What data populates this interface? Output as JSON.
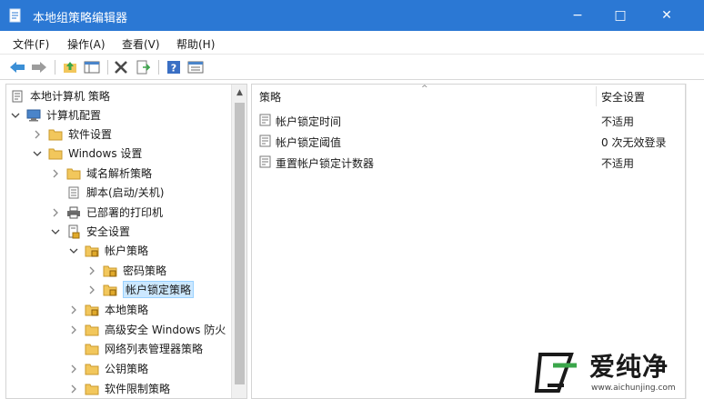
{
  "window": {
    "title": "本地组策略编辑器",
    "minimize_glyph": "−",
    "maximize_glyph": "□",
    "close_glyph": "✕"
  },
  "menu": [
    "文件(F)",
    "操作(A)",
    "查看(V)",
    "帮助(H)"
  ],
  "toolbar_icons": [
    "back-arrow-icon",
    "forward-arrow-icon",
    "folder-up-icon",
    "show-hide-tree-icon",
    "delete-icon",
    "export-list-icon",
    "help-icon",
    "properties-icon"
  ],
  "tree": {
    "chevron_expanded": "⌵",
    "chevron_collapsed": "›",
    "items": [
      {
        "label": "本地计算机 策略",
        "icon": "policy-doc-icon",
        "expander": "none",
        "level": 0
      },
      {
        "label": "计算机配置",
        "icon": "computer-icon",
        "expander": "expanded",
        "level": 0
      },
      {
        "label": "软件设置",
        "icon": "folder-icon",
        "expander": "collapsed",
        "level": 1
      },
      {
        "label": "Windows 设置",
        "icon": "folder-icon",
        "expander": "expanded",
        "level": 1
      },
      {
        "label": "域名解析策略",
        "icon": "folder-icon",
        "expander": "collapsed",
        "level": 2
      },
      {
        "label": "脚本(启动/关机)",
        "icon": "script-icon",
        "expander": "none",
        "level": 2
      },
      {
        "label": "已部署的打印机",
        "icon": "printer-icon",
        "expander": "collapsed",
        "level": 2
      },
      {
        "label": "安全设置",
        "icon": "security-settings-icon",
        "expander": "expanded",
        "level": 2
      },
      {
        "label": "帐户策略",
        "icon": "locked-folder-icon",
        "expander": "expanded",
        "level": 3
      },
      {
        "label": "密码策略",
        "icon": "locked-folder-icon",
        "expander": "collapsed",
        "level": 4
      },
      {
        "label": "帐户锁定策略",
        "icon": "locked-folder-icon",
        "expander": "collapsed",
        "level": 4,
        "selected": true
      },
      {
        "label": "本地策略",
        "icon": "locked-folder-icon",
        "expander": "collapsed",
        "level": 3
      },
      {
        "label": "高级安全 Windows 防火",
        "icon": "folder-icon",
        "expander": "collapsed",
        "level": 3
      },
      {
        "label": "网络列表管理器策略",
        "icon": "folder-icon",
        "expander": "none",
        "level": 3
      },
      {
        "label": "公钥策略",
        "icon": "folder-icon",
        "expander": "collapsed",
        "level": 3
      },
      {
        "label": "软件限制策略",
        "icon": "folder-icon",
        "expander": "collapsed",
        "level": 3
      }
    ]
  },
  "list": {
    "columns": [
      "策略",
      "安全设置"
    ],
    "sort_glyph": "^",
    "rows": [
      {
        "name": "帐户锁定时间",
        "value": "不适用"
      },
      {
        "name": "帐户锁定阈值",
        "value": "0 次无效登录"
      },
      {
        "name": "重置帐户锁定计数器",
        "value": "不适用"
      }
    ]
  },
  "watermark": {
    "text": "爱纯净",
    "url": "www.aichunjing.com"
  },
  "colors": {
    "titlebar": "#2b78d4",
    "selection": "#cce8ff",
    "folder": "#f2c75c"
  }
}
